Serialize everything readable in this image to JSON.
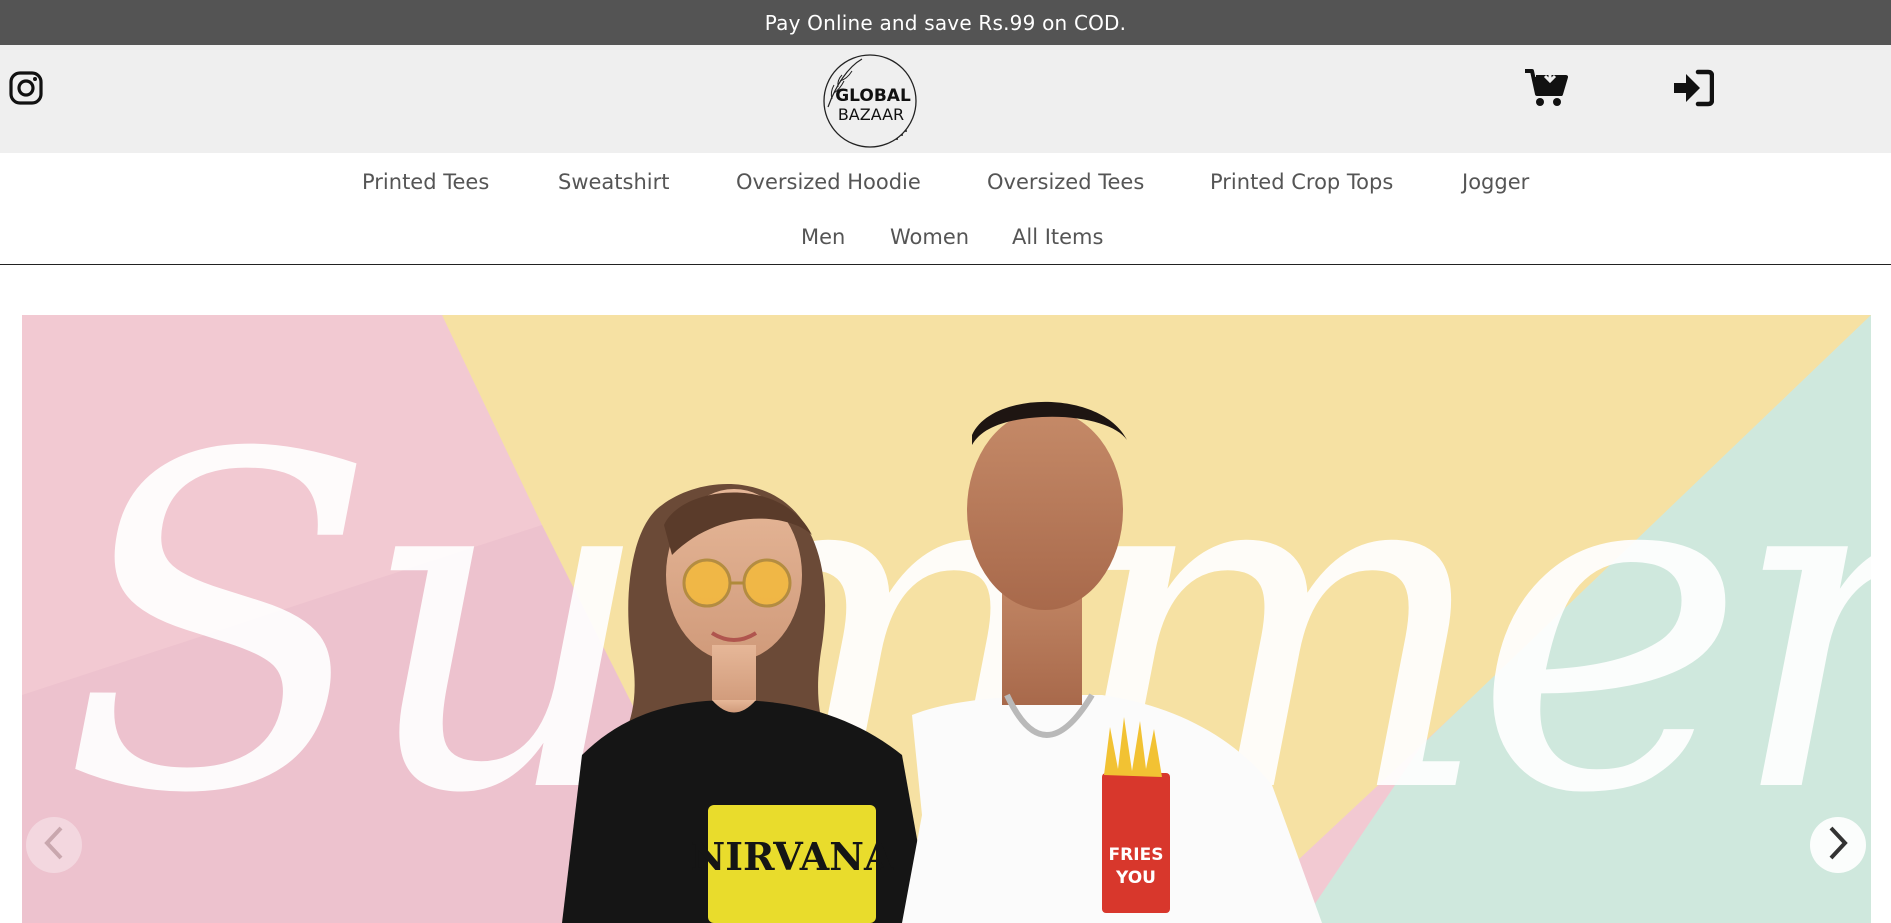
{
  "announcement": {
    "text": "Pay Online and save Rs.99 on COD."
  },
  "header": {
    "logo_line1": "GLOBAL",
    "logo_line2": "BAZAAR",
    "icons": {
      "social": "instagram-icon",
      "cart": "cart-icon",
      "login": "login-icon"
    }
  },
  "nav": {
    "row1": [
      {
        "label": "Printed Tees"
      },
      {
        "label": "Sweatshirt"
      },
      {
        "label": "Oversized Hoodie"
      },
      {
        "label": "Oversized Tees"
      },
      {
        "label": "Printed Crop Tops"
      },
      {
        "label": "Jogger"
      }
    ],
    "row2": [
      {
        "label": "Men"
      },
      {
        "label": "Women"
      },
      {
        "label": "All Items"
      }
    ]
  },
  "hero": {
    "banner_word": "Summer",
    "tee_print_1": "NIRVANA",
    "tee_print_2a": "FRIES",
    "tee_print_2b": "YOU",
    "colors": {
      "pink": "#f2c9d2",
      "yellow": "#f6e1a3",
      "mint": "#cfe8dd"
    }
  },
  "carousel": {
    "prev_icon": "chevron-left-icon",
    "next_icon": "chevron-right-icon"
  }
}
